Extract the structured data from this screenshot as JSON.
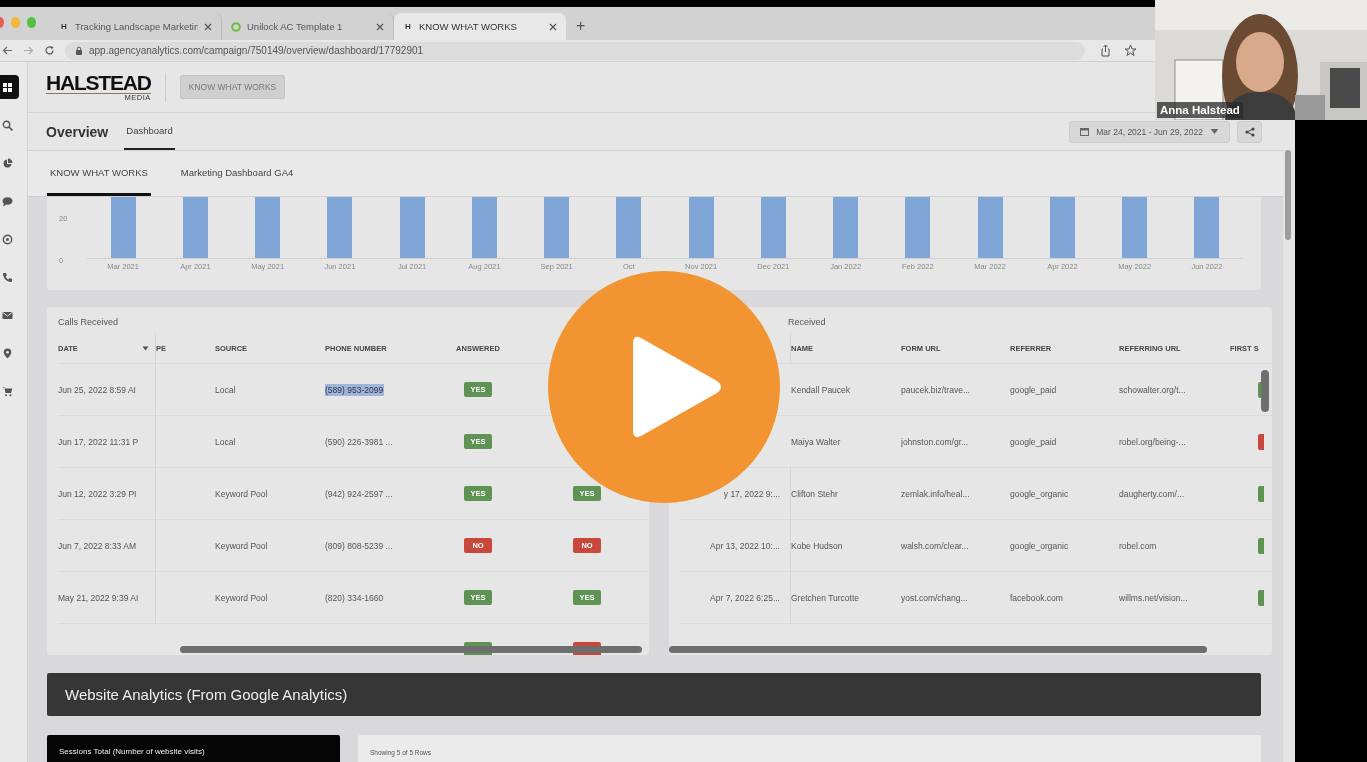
{
  "browser": {
    "tabs": [
      {
        "favicon": "H",
        "title": "Tracking Landscape Marketin",
        "selected": false
      },
      {
        "title": "Unilock AC Template 1",
        "selected": false
      },
      {
        "favicon": "H",
        "title": "KNOW WHAT WORKS",
        "selected": true
      }
    ],
    "new_tab": "+",
    "url": "app.agencyanalytics.com/campaign/750149/overview/dashboard/17792901"
  },
  "sidebar": {
    "items": [
      {
        "selected": true
      },
      {
        "selected": false
      },
      {
        "selected": false
      },
      {
        "selected": false
      },
      {
        "selected": false
      },
      {
        "selected": false
      },
      {
        "selected": false
      },
      {
        "selected": false
      },
      {
        "selected": false
      }
    ]
  },
  "header": {
    "logo": "HALSTEAD",
    "logo_sub": "MEDIA",
    "dashboard_button": "KNOW WHAT WORKS"
  },
  "overview": {
    "title": "Overview",
    "tabs": [
      {
        "label": "Dashboard",
        "selected": true
      }
    ],
    "date_range": "Mar 24, 2021 - Jun 29, 2022"
  },
  "dashboard_tabs": [
    {
      "label": "KNOW WHAT WORKS",
      "selected": true
    },
    {
      "label": "Marketing Dashboard GA4",
      "selected": false
    }
  ],
  "chart": {
    "y_ticks": [
      "20",
      "0"
    ],
    "x_labels": [
      "Mar 2021",
      "Apr 2021",
      "May 2021",
      "Jun 2021",
      "Jul 2021",
      "Aug 2021",
      "Sep 2021",
      "Oct",
      "Nov 2021",
      "Dec 2021",
      "Jan 2022",
      "Feb 2022",
      "Mar 2022",
      "Apr 2022",
      "May 2022",
      "Jun 2022"
    ]
  },
  "calls": {
    "title": "Calls Received",
    "columns": [
      {
        "label": "DATE",
        "sorted": true
      },
      {
        "label": "PE",
        "sorted": false
      },
      {
        "label": "SOURCE",
        "sorted": false
      },
      {
        "label": "PHONE NUMBER",
        "sorted": false
      },
      {
        "label": "ANSWERED",
        "sorted": false
      }
    ],
    "rows": [
      {
        "date": "Jun 25, 2022 8:59 AI",
        "source": "Local",
        "phone": "(589) 953-2099",
        "phone_highlighted": true,
        "answered": {
          "label": "YES",
          "ok": true
        }
      },
      {
        "date": "Jun 17, 2022 11:31 P",
        "source": "Local",
        "phone": "(590) 226-3981 ...",
        "phone_highlighted": false,
        "answered": {
          "label": "YES",
          "ok": true
        }
      },
      {
        "date": "Jun 12, 2022 3:29 PI",
        "source": "Keyword Pool",
        "phone": "(942) 924-2597 ...",
        "phone_highlighted": false,
        "answered": {
          "label": "YES",
          "ok": true
        },
        "column_6": {
          "label": "YES",
          "ok": true
        }
      },
      {
        "date": "Jun 7, 2022 8:33 AM",
        "source": "Keyword Pool",
        "phone": "(809) 808-5239 ...",
        "phone_highlighted": false,
        "answered": {
          "label": "NO",
          "ok": false
        },
        "column_6": {
          "label": "NO",
          "ok": false
        }
      },
      {
        "date": "May 21, 2022 9:39 AI",
        "source": "Keyword Pool",
        "phone": "(820) 334-1660",
        "phone_highlighted": false,
        "answered": {
          "label": "YES",
          "ok": true
        },
        "column_6": {
          "label": "YES",
          "ok": true
        }
      },
      {
        "answered": {
          "ok": true
        },
        "column_6": {
          "ok": false
        }
      }
    ]
  },
  "forms": {
    "title": "Received",
    "columns": [
      "NAME",
      "FORM URL",
      "REFERRER",
      "REFERRING URL",
      "FIRST S"
    ],
    "rows": [
      {
        "name": "Kendall Paucek",
        "form_url": "paucek.biz/trave...",
        "referrer": "google_paid",
        "referring_url": "schowalter.org/t...",
        "first_ok": true
      },
      {
        "name": "Maiya Walter",
        "form_url": "johnston.com/gr...",
        "referrer": "google_paid",
        "referring_url": "robel.org/being-...",
        "first_ok": false
      },
      {
        "date": "y 17, 2022 9:...",
        "name": "Clifton Stehr",
        "form_url": "zemlak.info/heal...",
        "referrer": "google_organic",
        "referring_url": "daugherty.com/...",
        "first_ok": true
      },
      {
        "date": "Apr 13, 2022 10:...",
        "name": "Kobe Hudson",
        "form_url": "walsh.com/clear...",
        "referrer": "google_organic",
        "referring_url": "robel.com",
        "first_ok": true
      },
      {
        "date": "Apr 7, 2022 6:25...",
        "name": "Gretchen Turcotte",
        "form_url": "yost.com/chang...",
        "referrer": "facebook.com",
        "referring_url": "willms.net/vision...",
        "first_ok": true
      }
    ]
  },
  "banner": "Website Analytics (From Google Analytics)",
  "sessions_card": {
    "title": "Sessions Total (Number of website visits)"
  },
  "rows_card": {
    "caption": "Showing 5 of 5 Rows"
  },
  "video_tile": {
    "name": "Anna Halstead"
  }
}
